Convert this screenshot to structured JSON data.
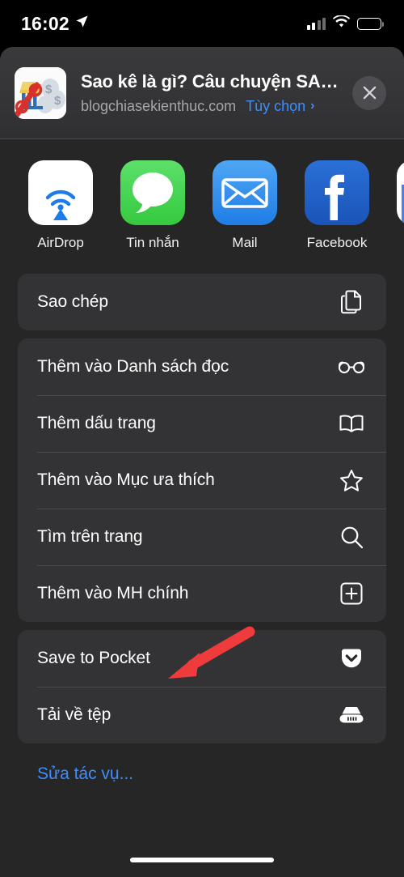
{
  "status_bar": {
    "time": "16:02",
    "location_icon": "location-arrow-icon",
    "signal_icon": "cellular-signal-icon",
    "wifi_icon": "wifi-icon",
    "battery_icon": "battery-icon"
  },
  "header": {
    "title": "Sao kê là gì? Câu chuyện SAO KÊ...",
    "domain": "blogchiasekienthuc.com",
    "options_label": "Tùy chọn",
    "options_chevron": "›",
    "close_label": "✕",
    "thumbnail_icon": "website-thumbnail-bank-dollar"
  },
  "apps": [
    {
      "label": "AirDrop",
      "icon": "airdrop-icon"
    },
    {
      "label": "Tin nhắn",
      "icon": "messages-icon"
    },
    {
      "label": "Mail",
      "icon": "mail-icon"
    },
    {
      "label": "Facebook",
      "icon": "facebook-icon"
    },
    {
      "label": "",
      "icon": "maps-icon"
    }
  ],
  "groups": [
    {
      "name": "copy-group",
      "rows": [
        {
          "label": "Sao chép",
          "icon": "copy-documents-icon"
        }
      ]
    },
    {
      "name": "safari-actions-group",
      "rows": [
        {
          "label": "Thêm vào Danh sách đọc",
          "icon": "glasses-icon"
        },
        {
          "label": "Thêm dấu trang",
          "icon": "book-icon"
        },
        {
          "label": "Thêm vào Mục ưa thích",
          "icon": "star-icon"
        },
        {
          "label": "Tìm trên trang",
          "icon": "search-icon"
        },
        {
          "label": "Thêm vào MH chính",
          "icon": "plus-square-icon"
        }
      ]
    },
    {
      "name": "extensions-group",
      "rows": [
        {
          "label": "Save to Pocket",
          "icon": "pocket-icon"
        },
        {
          "label": "Tải về tệp",
          "icon": "download-server-icon"
        }
      ]
    }
  ],
  "edit_actions": {
    "label": "Sửa tác vụ..."
  },
  "annotation": {
    "arrow_icon": "red-pointer-arrow",
    "color": "#ef3b3b",
    "points_to": "Save to Pocket"
  },
  "colors": {
    "background": "#000000",
    "sheet": "#262626",
    "group": "#333335",
    "header": "#3a3a3c",
    "accent_blue": "#3f8dfd",
    "text_primary": "#ffffff",
    "text_secondary": "#a7a7ab",
    "annotation_red": "#ef3b3b"
  },
  "home_indicator": {
    "icon": "home-indicator"
  }
}
